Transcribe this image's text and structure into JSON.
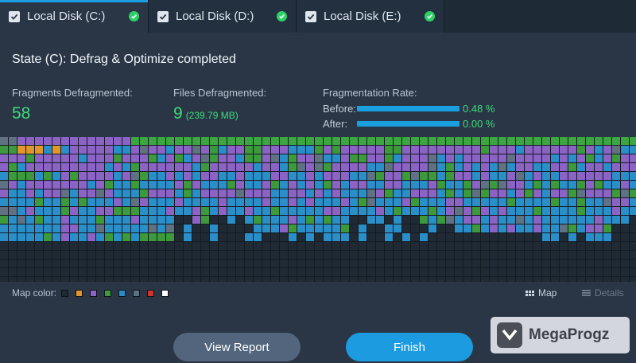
{
  "tabs": [
    {
      "label": "Local Disk (C:)",
      "active": true
    },
    {
      "label": "Local Disk (D:)",
      "active": false
    },
    {
      "label": "Local Disk (E:)",
      "active": false
    }
  ],
  "state_text": "State (C): Defrag & Optimize completed",
  "stats": {
    "fragments_label": "Fragments Defragmented:",
    "fragments_value": "58",
    "files_label": "Files Defragmented:",
    "files_value": "9",
    "files_size": "(239.79 MB)",
    "rate_label": "Fragmentation Rate:",
    "before_label": "Before:",
    "before_value": "0.48 %",
    "after_label": "After:",
    "after_value": "0.00 %"
  },
  "map": {
    "legend_label": "Map color:",
    "legend_colors": [
      "#1f2a35",
      "#e0962a",
      "#8b63c4",
      "#3c9a3c",
      "#2a8ec8",
      "#5f7182",
      "#d0352b",
      "#ffffff"
    ],
    "map_view_label": "Map",
    "details_view_label": "Details"
  },
  "colors": {
    "accent": "#1aa0e0",
    "success": "#3ddc7a",
    "background": "#2a3646"
  },
  "buttons": {
    "view_report": "View Report",
    "finish": "Finish"
  },
  "watermark": "MegaProgz"
}
